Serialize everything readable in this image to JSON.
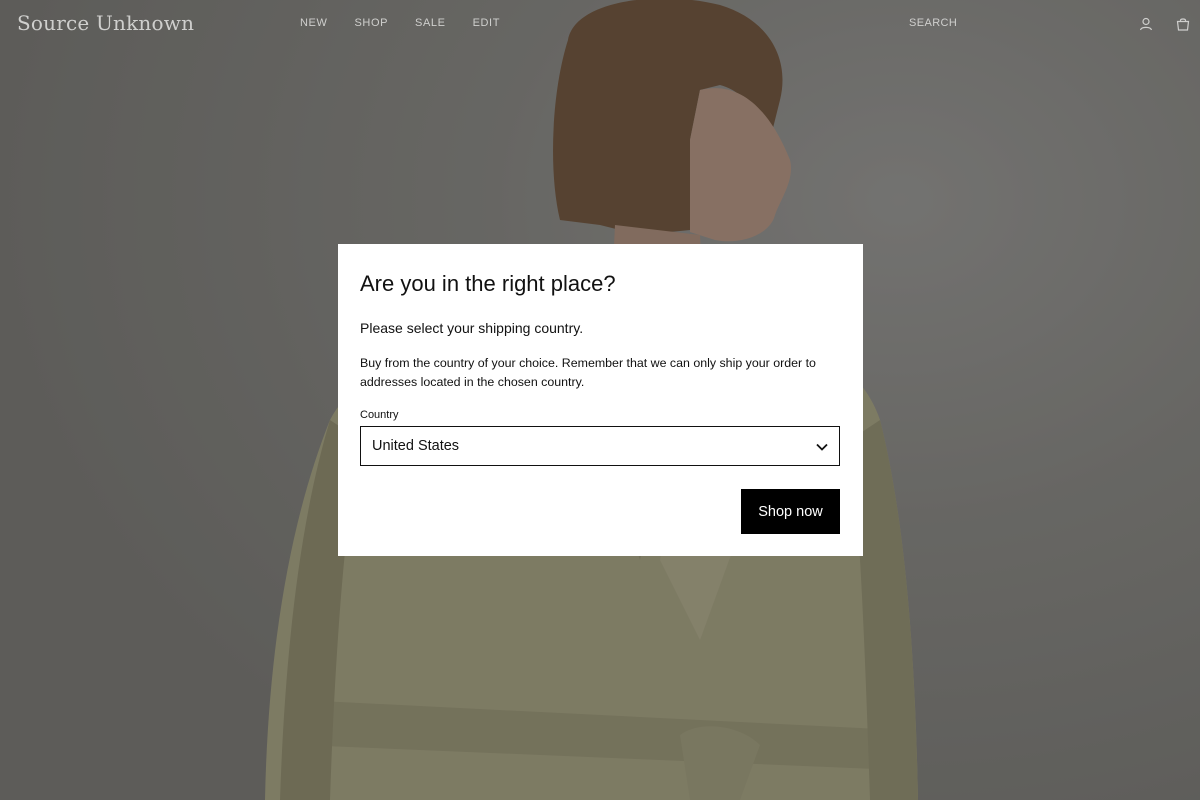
{
  "header": {
    "logo": "Source Unknown",
    "nav": [
      {
        "label": "NEW"
      },
      {
        "label": "SHOP"
      },
      {
        "label": "SALE"
      },
      {
        "label": "EDIT"
      }
    ],
    "search_label": "SEARCH",
    "icons": {
      "account": "user-icon",
      "cart": "bag-icon"
    }
  },
  "modal": {
    "title": "Are you in the right place?",
    "subtitle": "Please select your shipping country.",
    "body": "Buy from the country of your choice. Remember that we can only ship your order to addresses located in the chosen country.",
    "country_label": "Country",
    "country_value": "United States",
    "button_label": "Shop now"
  },
  "colors": {
    "overlay": "#1e1e1e",
    "modal_bg": "#ffffff",
    "button_bg": "#000000",
    "coat": "#b9b58f"
  }
}
